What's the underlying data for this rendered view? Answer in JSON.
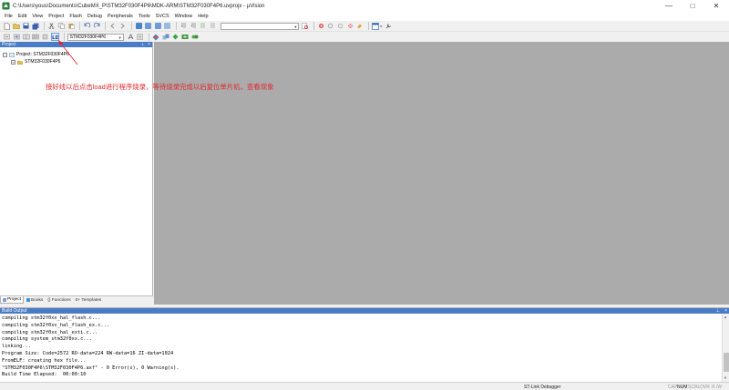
{
  "window": {
    "title": "C:\\Users\\yous\\Documents\\CubeMX_P\\STM32F030F4P6\\MDK-ARM\\STM32F030F4P6.uvprojx - µVision",
    "controls": {
      "minimize": "—",
      "maximize": "□",
      "close": "✕"
    }
  },
  "menu": {
    "items": [
      "File",
      "Edit",
      "View",
      "Project",
      "Flash",
      "Debug",
      "Peripherals",
      "Tools",
      "SVCS",
      "Window",
      "Help"
    ]
  },
  "toolbar": {
    "target_select": "STM32F030F4P6",
    "load_button_icon": "load-icon"
  },
  "project_panel": {
    "title": "Project",
    "root_label": "Project: STM32F030F4P6",
    "target_label": "STM32F030F4P6",
    "tabs": [
      "Project",
      "Books",
      "{} Functions",
      "0+ Templates"
    ]
  },
  "build_output": {
    "title": "Build Output",
    "lines": [
      "compiling stm32f0xx_hal_flash.c...",
      "compiling stm32f0xx_hal_flash_ex.c...",
      "compiling stm32f0xx_hal_exti.c...",
      "compiling system_stm32f0xx.c...",
      "linking...",
      "Program Size: Code=2572 RO-data=224 RW-data=16 ZI-data=1024",
      "FromELF: creating hex file...",
      "\"STM32F030F4P6\\STM32F030F4P6.axf\" - 0 Error(s), 0 Warning(s).",
      "Build Time Elapsed:  00:00:10"
    ]
  },
  "status_bar": {
    "debugger": "ST-Link Debugger",
    "indicators": [
      "CAP",
      "NUM",
      "SCRL",
      "OVR",
      "R /W"
    ]
  },
  "annotation": {
    "text": "接好线以后点击load进行程序烧录，等待烧录完成以后复位单片机，查看现象",
    "color": "#e0282e"
  },
  "colors": {
    "panel_header": "#4a7bc5",
    "editor_background": "#ababab",
    "window_background": "#f0f0f0"
  }
}
